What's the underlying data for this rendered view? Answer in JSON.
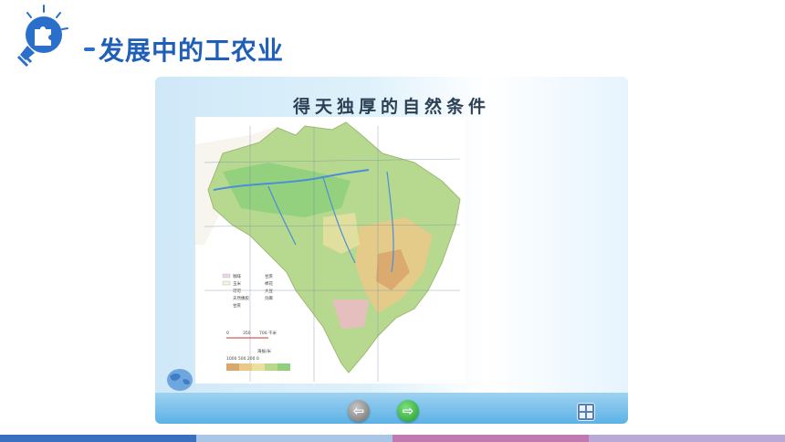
{
  "header": {
    "title": "发展中的工农业"
  },
  "slide": {
    "title": "得天独厚的自然条件"
  },
  "controls": {
    "prev_label": "⇦",
    "next_label": "⇨"
  },
  "map": {
    "legend_items": [
      "咖啡",
      "甘蔗",
      "玉米",
      "棉花",
      "可可",
      "大豆",
      "天然橡胶",
      "剑麻",
      "甘蔗"
    ],
    "scale_labels": [
      "0",
      "350",
      "700 千米"
    ],
    "elevation_label": "海拔/米",
    "elevation_ticks": [
      "1000",
      "500",
      "200",
      "0"
    ]
  },
  "colors": {
    "title": "#1f5fb8",
    "stripe_blue": "#3b6fc0",
    "stripe_light": "#a9c6e6",
    "stripe_pink": "#c07ab0",
    "stripe_lavender": "#b9a9d6"
  }
}
